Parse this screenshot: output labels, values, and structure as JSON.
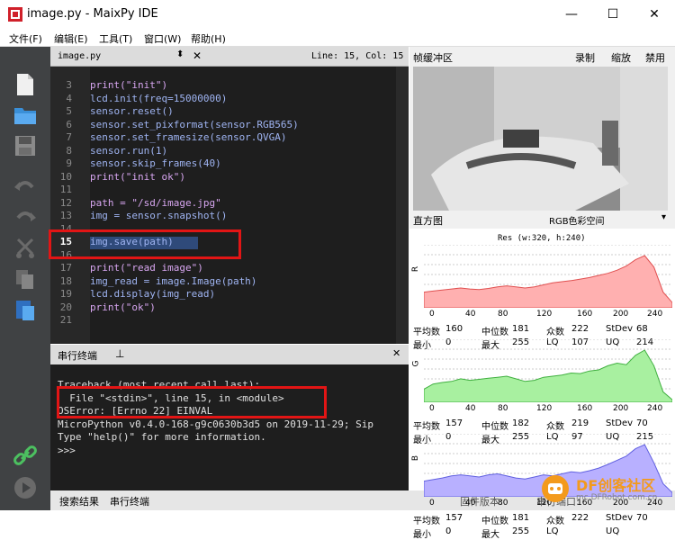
{
  "window": {
    "title": "image.py - MaixPy IDE",
    "minimize": "—",
    "maximize": "☐",
    "close": "✕"
  },
  "menu": [
    "文件(F)",
    "编辑(E)",
    "工具(T)",
    "窗口(W)",
    "帮助(H)"
  ],
  "toolbar": [
    "new-file",
    "open-folder",
    "save",
    "undo",
    "redo",
    "cut",
    "copy",
    "paste",
    "connect",
    "run"
  ],
  "editor": {
    "tab_name": "image.py",
    "cursor_pos": "Line: 15, Col: 15",
    "lines": [
      {
        "n": "3",
        "text": "print(\"init\")"
      },
      {
        "n": "4",
        "text": "lcd.init(freq=15000000)"
      },
      {
        "n": "5",
        "text": "sensor.reset()"
      },
      {
        "n": "6",
        "text": "sensor.set_pixformat(sensor.RGB565)"
      },
      {
        "n": "7",
        "text": "sensor.set_framesize(sensor.QVGA)"
      },
      {
        "n": "8",
        "text": "sensor.run(1)"
      },
      {
        "n": "9",
        "text": "sensor.skip_frames(40)"
      },
      {
        "n": "10",
        "text": "print(\"init ok\")"
      },
      {
        "n": "11",
        "text": ""
      },
      {
        "n": "12",
        "text": "path = \"/sd/image.jpg\""
      },
      {
        "n": "13",
        "text": "img = sensor.snapshot()"
      },
      {
        "n": "14",
        "text": ""
      },
      {
        "n": "15",
        "text": "img.save(path)"
      },
      {
        "n": "16",
        "text": ""
      },
      {
        "n": "17",
        "text": "print(\"read image\")"
      },
      {
        "n": "18",
        "text": "img_read = image.Image(path)"
      },
      {
        "n": "19",
        "text": "lcd.display(img_read)"
      },
      {
        "n": "20",
        "text": "print(\"ok\")"
      },
      {
        "n": "21",
        "text": ""
      }
    ]
  },
  "serial": {
    "tab_label": "串行终端",
    "lines": [
      "Traceback (most recent call last):",
      "  File \"<stdin>\", line 15, in <module>",
      "OSError: [Errno 22] EINVAL",
      "MicroPython v0.4.0-168-g9c0630b3d5 on 2019-11-29; Sip",
      "Type \"help()\" for more information.",
      ">>>"
    ]
  },
  "bottom": {
    "tab1": "搜索结果",
    "tab2": "串行终端",
    "firmware": "固件版本:",
    "serial_port": "串行端口:"
  },
  "framebuffer": {
    "title": "帧缓冲区",
    "record": "录制",
    "zoom": "缩放",
    "disable": "禁用"
  },
  "histogram": {
    "title": "直方图",
    "colorspace": "RGB色彩空间",
    "res": "Res (w:320, h:240)",
    "ticks": [
      "0",
      "40",
      "80",
      "120",
      "160",
      "200",
      "240"
    ],
    "channels": [
      {
        "label": "R",
        "color": "#ffb0b0",
        "stroke": "#e05050",
        "mean_label": "平均数",
        "mean": "160",
        "median_label": "中位数",
        "median": "181",
        "mode_label": "众数",
        "mode": "222",
        "stdev_label": "StDev",
        "stdev": "68",
        "min_label": "最小",
        "min": "0",
        "max_label": "最大",
        "max": "255",
        "lq_label": "LQ",
        "lq": "107",
        "uq_label": "UQ",
        "uq": "214",
        "profile": [
          0.3,
          0.32,
          0.34,
          0.36,
          0.38,
          0.36,
          0.35,
          0.37,
          0.4,
          0.42,
          0.4,
          0.38,
          0.4,
          0.44,
          0.48,
          0.5,
          0.52,
          0.55,
          0.58,
          0.62,
          0.66,
          0.72,
          0.8,
          0.92,
          1.0,
          0.78,
          0.3,
          0.1
        ]
      },
      {
        "label": "G",
        "color": "#a8f0a0",
        "stroke": "#40b040",
        "mean_label": "平均数",
        "mean": "157",
        "median_label": "中位数",
        "median": "182",
        "mode_label": "众数",
        "mode": "219",
        "stdev_label": "StDev",
        "stdev": "70",
        "min_label": "最小",
        "min": "0",
        "max_label": "最大",
        "max": "255",
        "lq_label": "LQ",
        "lq": "97",
        "uq_label": "UQ",
        "uq": "215",
        "profile": [
          0.25,
          0.35,
          0.38,
          0.4,
          0.45,
          0.42,
          0.44,
          0.46,
          0.48,
          0.5,
          0.45,
          0.4,
          0.42,
          0.48,
          0.5,
          0.52,
          0.56,
          0.55,
          0.6,
          0.62,
          0.7,
          0.75,
          0.72,
          0.9,
          1.0,
          0.7,
          0.2,
          0.05
        ]
      },
      {
        "label": "B",
        "color": "#b8b0ff",
        "stroke": "#6060e0",
        "mean_label": "平均数",
        "mean": "157",
        "median_label": "中位数",
        "median": "181",
        "mode_label": "众数",
        "mode": "222",
        "stdev_label": "StDev",
        "stdev": "70",
        "min_label": "最小",
        "min": "0",
        "max_label": "最大",
        "max": "255",
        "lq_label": "LQ",
        "lq": "",
        "uq_label": "UQ",
        "uq": ""
      },
      {
        "note": ""
      }
    ]
  },
  "watermark": "DF创客社区",
  "watermark_url": "mc.DFRobot.com.cn"
}
